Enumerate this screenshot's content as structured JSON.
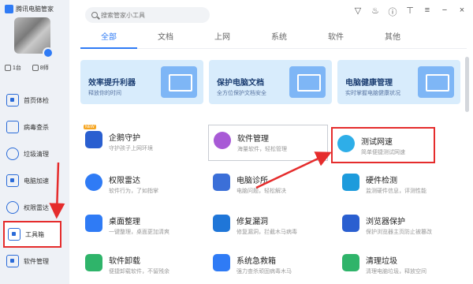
{
  "app": {
    "title": "腾讯电脑管家"
  },
  "sidebar": {
    "stats": [
      {
        "icon": "monitor-icon",
        "label": "1台"
      },
      {
        "icon": "phone-icon",
        "label": "8师"
      }
    ],
    "items": [
      {
        "label": "首页体检",
        "icon": "monitor-check-icon"
      },
      {
        "label": "病毒查杀",
        "icon": "shield-icon"
      },
      {
        "label": "垃圾清理",
        "icon": "broom-icon"
      },
      {
        "label": "电脑加速",
        "icon": "rocket-icon"
      },
      {
        "label": "权限雷达",
        "icon": "radar-icon"
      },
      {
        "label": "工具箱",
        "icon": "toolbox-icon"
      },
      {
        "label": "软件管理",
        "icon": "apps-icon"
      }
    ]
  },
  "search": {
    "placeholder": "搜索管家小工具"
  },
  "top_icons": [
    "skin-icon",
    "fire-icon",
    "info-icon",
    "shirt-icon",
    "menu-icon",
    "minimize-icon",
    "close-icon"
  ],
  "tabs": [
    {
      "label": "全部"
    },
    {
      "label": "文档"
    },
    {
      "label": "上网"
    },
    {
      "label": "系统"
    },
    {
      "label": "软件"
    },
    {
      "label": "其他"
    }
  ],
  "banners": [
    {
      "title": "效率提升利器",
      "subtitle": "释放你的时间"
    },
    {
      "title": "保护电脑文档",
      "subtitle": "全方位保护文档安全"
    },
    {
      "title": "电脑健康管理",
      "subtitle": "实时掌握电脑健康状况"
    }
  ],
  "tools": [
    {
      "name": "企鹅守护",
      "desc": "守护孩子上网环境",
      "badge": "NEW"
    },
    {
      "name": "软件管理",
      "desc": "海量软件，轻松管理"
    },
    {
      "name": "测试网速",
      "desc": "简单便捷测试网速"
    },
    {
      "name": "权限雷达",
      "desc": "软件行为，了如指掌"
    },
    {
      "name": "电脑诊所",
      "desc": "电脑问题，轻松解决"
    },
    {
      "name": "硬件检测",
      "desc": "监测硬件信息，评测性能"
    },
    {
      "name": "桌面整理",
      "desc": "一键整理，桌面更加清爽"
    },
    {
      "name": "修复漏洞",
      "desc": "修复漏洞，拦截木马病毒"
    },
    {
      "name": "浏览器保护",
      "desc": "保护浏览器主页防止被篡改"
    },
    {
      "name": "软件卸载",
      "desc": "便捷卸载软件，不留残余"
    },
    {
      "name": "系统急救箱",
      "desc": "强力查杀顽固病毒木马"
    },
    {
      "name": "清理垃圾",
      "desc": "清理电脑垃圾，释放空间"
    }
  ],
  "colors": {
    "accent": "#2f7bf5",
    "annotation": "#e52c2c"
  }
}
